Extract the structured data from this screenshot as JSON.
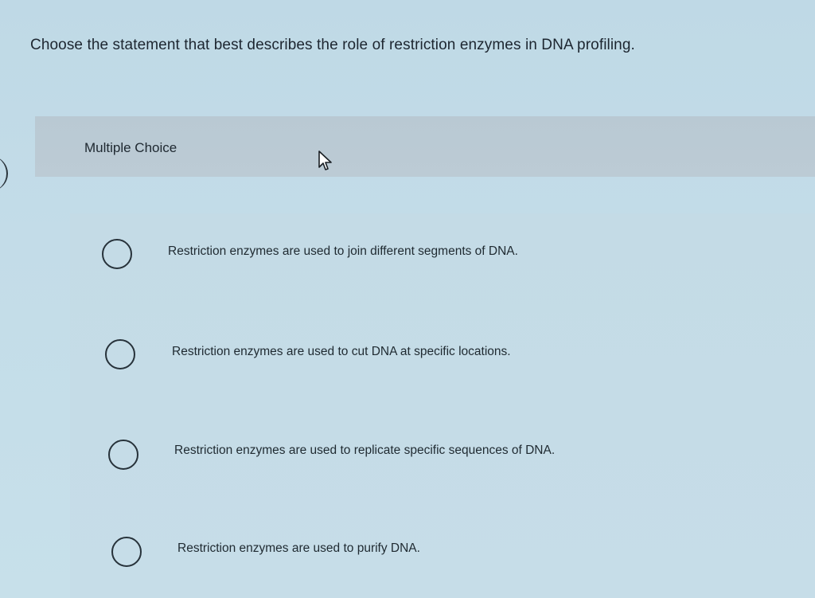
{
  "question": {
    "text": "Choose the statement that best describes the role of restriction enzymes in DNA profiling."
  },
  "question_type": {
    "label": "Multiple Choice"
  },
  "options": [
    {
      "label": "Restriction enzymes are used to join different segments of DNA."
    },
    {
      "label": "Restriction enzymes are used to cut DNA at specific locations."
    },
    {
      "label": "Restriction enzymes are used to replicate specific sequences of DNA."
    },
    {
      "label": "Restriction enzymes are used to purify DNA."
    }
  ],
  "icons": {
    "cursor": "mouse-pointer-icon",
    "radio": "radio-unselected-icon"
  },
  "colors": {
    "background": "#c3dce8",
    "header_band": "#bccbd5",
    "text": "#1e2a33"
  }
}
